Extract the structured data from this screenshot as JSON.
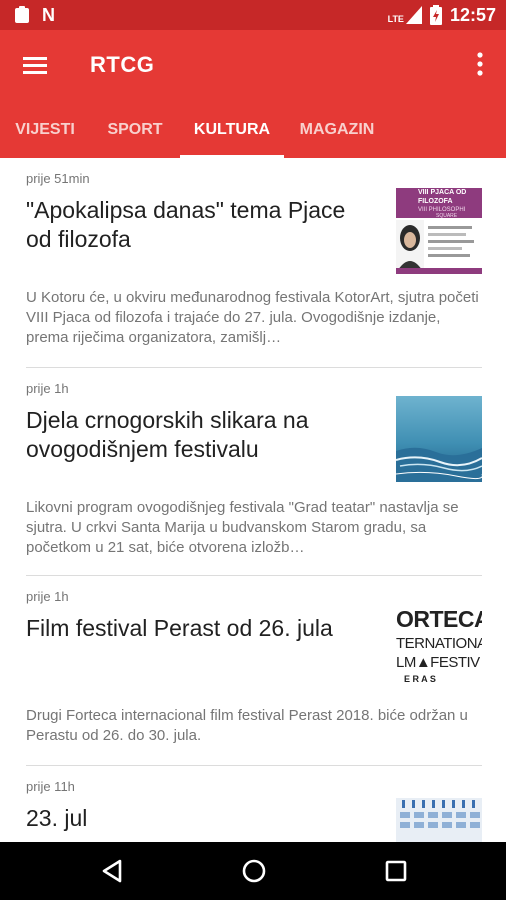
{
  "status_bar": {
    "time": "12:57",
    "left_icons": [
      "clipboard-icon",
      "notification-n-icon"
    ],
    "right_icons": [
      "lte-signal-icon",
      "battery-charging-icon"
    ],
    "network_label": "LTE",
    "notification_letter": "N"
  },
  "app_bar": {
    "title": "RTCG",
    "menu_icon": "hamburger-menu-icon",
    "overflow_icon": "more-vert-icon"
  },
  "tabs": [
    {
      "label": "VIJESTI",
      "active": false
    },
    {
      "label": "SPORT",
      "active": false
    },
    {
      "label": "KULTURA",
      "active": true
    },
    {
      "label": "MAGAZIN",
      "active": false
    }
  ],
  "articles": [
    {
      "time": "prije 51min",
      "title": "\"Apokalipsa danas\" tema Pjace od filozofa",
      "summary": "U Kotoru će, u okviru međunarodnog festivala KotorArt, sjutra početi VIII Pjaca od filozofa i trajaće do 27. jula. Ovogodišnje izdanje, prema riječima organizatora, zamišlj…",
      "thumb": {
        "kind": "poster",
        "line1": "VIII PJACA OD",
        "line2": "FILOZOFA",
        "line3": "VIII PHILOSOPHI",
        "line4": "SQUARE",
        "side": "ART"
      }
    },
    {
      "time": "prije 1h",
      "title": "Djela crnogorskih slikara na ovogodišnjem festivalu",
      "summary": "Likovni program ovogodišnjeg festivala \"Grad teatar\" nastavlja se sjutra. U crkvi Santa Marija u budvanskom Starom gradu, sa početkom u 21 sat, biće otvorena izložb…",
      "thumb": {
        "kind": "painting"
      }
    },
    {
      "time": "prije 1h",
      "title": "Film festival Perast od 26. jula",
      "summary": "Drugi Forteca internacional film festival Perast 2018. biće održan u Perastu od 26. do 30. jula.",
      "thumb": {
        "kind": "logo",
        "line1": "ORTECA",
        "line2": "TERNATIONA",
        "line3": "LM▲FESTIV",
        "line4": "E R A S"
      }
    },
    {
      "time": "prije 11h",
      "title": "23. jul",
      "summary": "",
      "thumb": {
        "kind": "calendar"
      }
    }
  ],
  "nav_bar": {
    "buttons": [
      "back-icon",
      "home-icon",
      "recents-icon"
    ]
  },
  "colors": {
    "status_bar": "#c62828",
    "app_bar": "#e53935",
    "text_primary": "#212121",
    "text_secondary": "#757575"
  }
}
